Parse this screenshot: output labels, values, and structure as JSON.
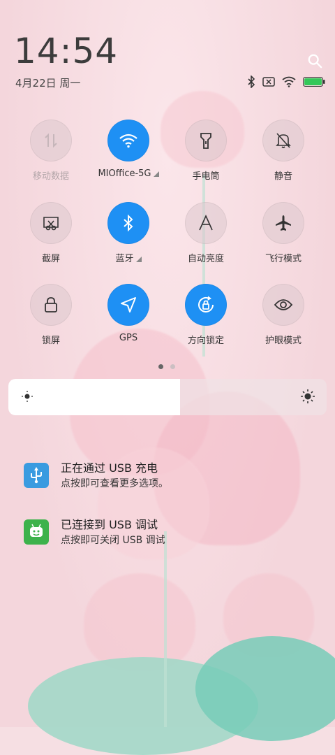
{
  "clock": {
    "time": "14:54"
  },
  "date": {
    "text": "4月22日 周一"
  },
  "status_bar": {
    "icons": [
      "bluetooth-icon",
      "sim-disabled-icon",
      "wifi-icon",
      "battery-icon"
    ],
    "battery_color": "#34c759"
  },
  "accent_color": "#1e90f4",
  "tiles": [
    {
      "label": "移动数据",
      "on": false,
      "icon": "mobile-data-icon"
    },
    {
      "label": "MIOffice-5G",
      "on": true,
      "icon": "wifi-icon"
    },
    {
      "label": "手电筒",
      "on": false,
      "icon": "flashlight-icon"
    },
    {
      "label": "静音",
      "on": false,
      "icon": "mute-icon"
    },
    {
      "label": "截屏",
      "on": false,
      "icon": "screenshot-icon"
    },
    {
      "label": "蓝牙",
      "on": true,
      "icon": "bluetooth-icon"
    },
    {
      "label": "自动亮度",
      "on": false,
      "icon": "auto-brightness-icon"
    },
    {
      "label": "飞行模式",
      "on": false,
      "icon": "airplane-icon"
    },
    {
      "label": "锁屏",
      "on": false,
      "icon": "lock-icon"
    },
    {
      "label": "GPS",
      "on": true,
      "icon": "gps-icon"
    },
    {
      "label": "方向锁定",
      "on": true,
      "icon": "rotation-lock-icon"
    },
    {
      "label": "护眼模式",
      "on": false,
      "icon": "eye-icon"
    }
  ],
  "pager": {
    "current": 1,
    "total": 2
  },
  "brightness": {
    "level": 0.54
  },
  "notifications": [
    {
      "title": "正在通过 USB 充电",
      "subtitle": "点按即可查看更多选项。",
      "icon": "usb-icon",
      "icon_color": "#3a9be0"
    },
    {
      "title": "已连接到 USB 调试",
      "subtitle": "点按即可关闭 USB 调试",
      "icon": "android-icon",
      "icon_color": "#3db24b"
    }
  ]
}
